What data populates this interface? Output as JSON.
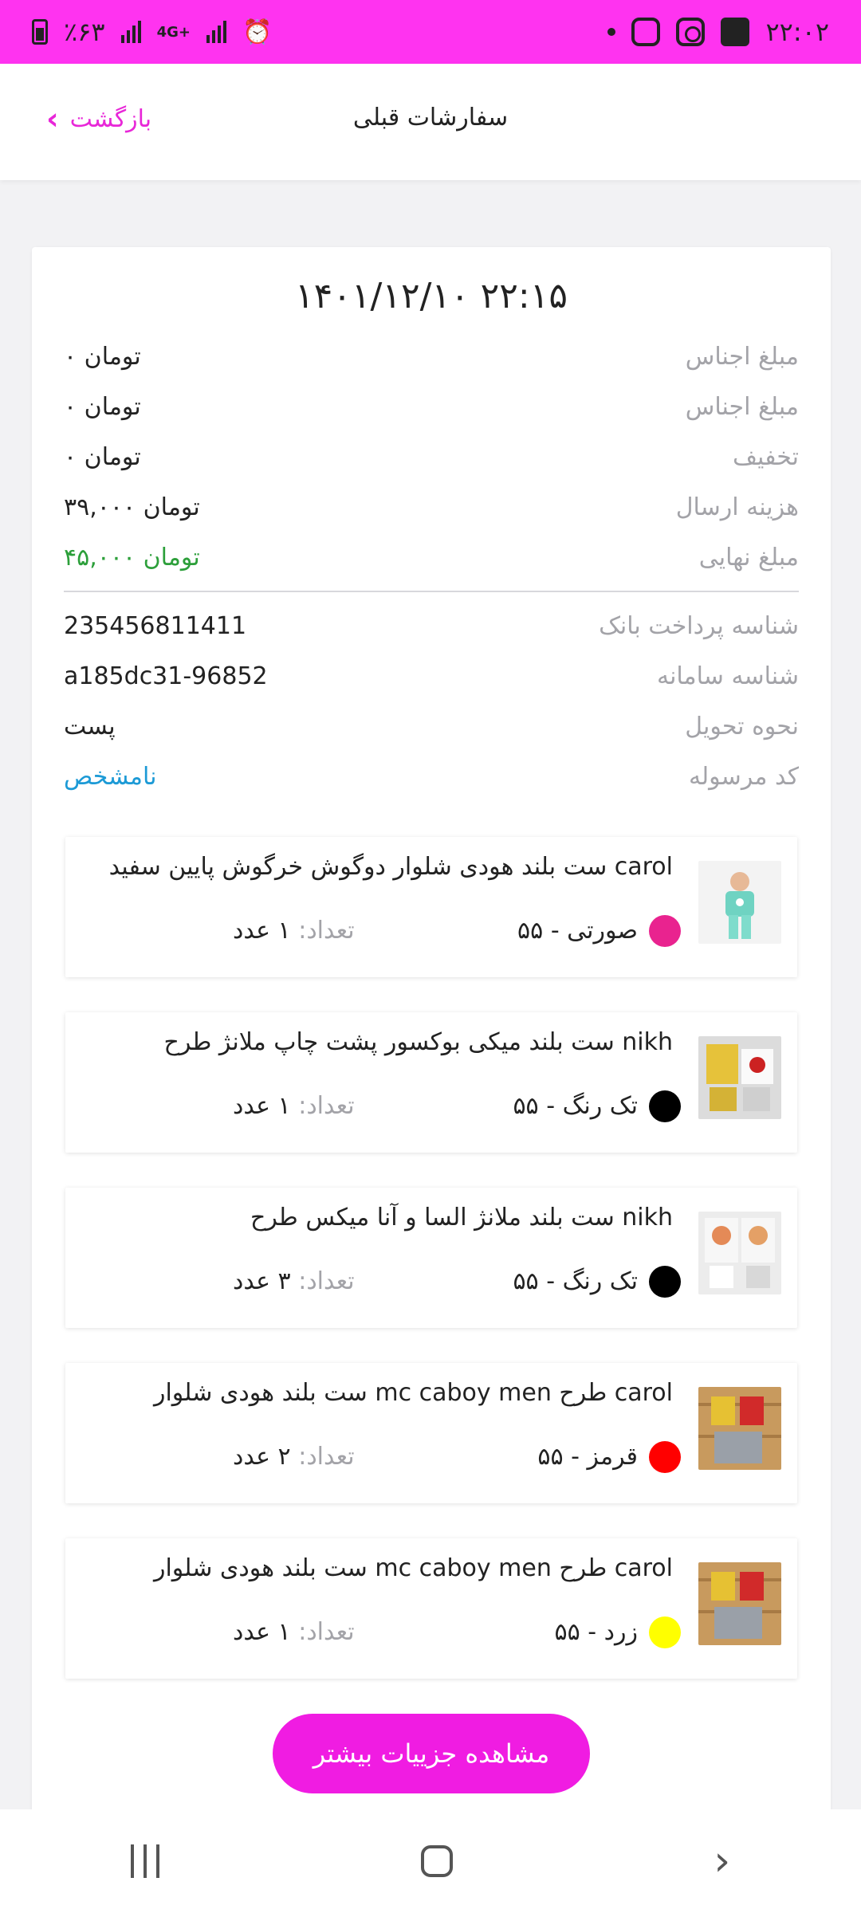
{
  "status_bar": {
    "time": "۲۲:۰۲",
    "battery": "٪۶۳",
    "network": "4G+"
  },
  "header": {
    "title": "سفارشات قبلی",
    "back_label": "بازگشت"
  },
  "order": {
    "datetime": "۱۴۰۱/۱۲/۱۰ ۲۲:۱۵",
    "rows": [
      {
        "label": "مبلغ اجناس",
        "value": "۰ تومان"
      },
      {
        "label": "مبلغ اجناس",
        "value": "۰ تومان"
      },
      {
        "label": "تخفیف",
        "value": "۰ تومان"
      },
      {
        "label": "هزینه ارسال",
        "value": "۳۹,۰۰۰ تومان"
      },
      {
        "label": "مبلغ نهایی",
        "value": "۴۵,۰۰۰ تومان"
      }
    ],
    "info_rows": [
      {
        "label": "شناسه پرداخت بانک",
        "value": "235456811411"
      },
      {
        "label": "شناسه سامانه",
        "value": "a185dc31-96852"
      },
      {
        "label": "نحوه تحویل",
        "value": "پست"
      },
      {
        "label": "کد مرسوله",
        "value": "نامشخص"
      }
    ],
    "colors": {
      "final_amount": "#2c9f3a",
      "tracking_unknown": "#1c9ad6",
      "accent": "#f01ce2"
    }
  },
  "items": [
    {
      "name": "ست بلند هودی شلوار دوگوش خرگوش پایین سفید carol",
      "variant": "صورتی  - ۵۵",
      "color": "#e9238f",
      "qty_label": "تعداد:",
      "qty_value": "۱ عدد"
    },
    {
      "name": "ست بلند میکی بوکسور پشت چاپ ملانژ طرح nikh",
      "variant": "تک رنگ  - ۵۵",
      "color": "#000000",
      "qty_label": "تعداد:",
      "qty_value": "۱ عدد"
    },
    {
      "name": "ست بلند ملانژ السا و آنا میکس طرح nikh",
      "variant": "تک رنگ  - ۵۵",
      "color": "#000000",
      "qty_label": "تعداد:",
      "qty_value": "۳ عدد"
    },
    {
      "name": "ست بلند هودی شلوار mc caboy men طرح carol",
      "variant": "قرمز  - ۵۵",
      "color": "#ff0000",
      "qty_label": "تعداد:",
      "qty_value": "۲ عدد"
    },
    {
      "name": "ست بلند هودی شلوار mc caboy men طرح carol",
      "variant": "زرد  - ۵۵",
      "color": "#ffff00",
      "qty_label": "تعداد:",
      "qty_value": "۱ عدد"
    }
  ],
  "more_button": "مشاهده جزییات بیشتر"
}
